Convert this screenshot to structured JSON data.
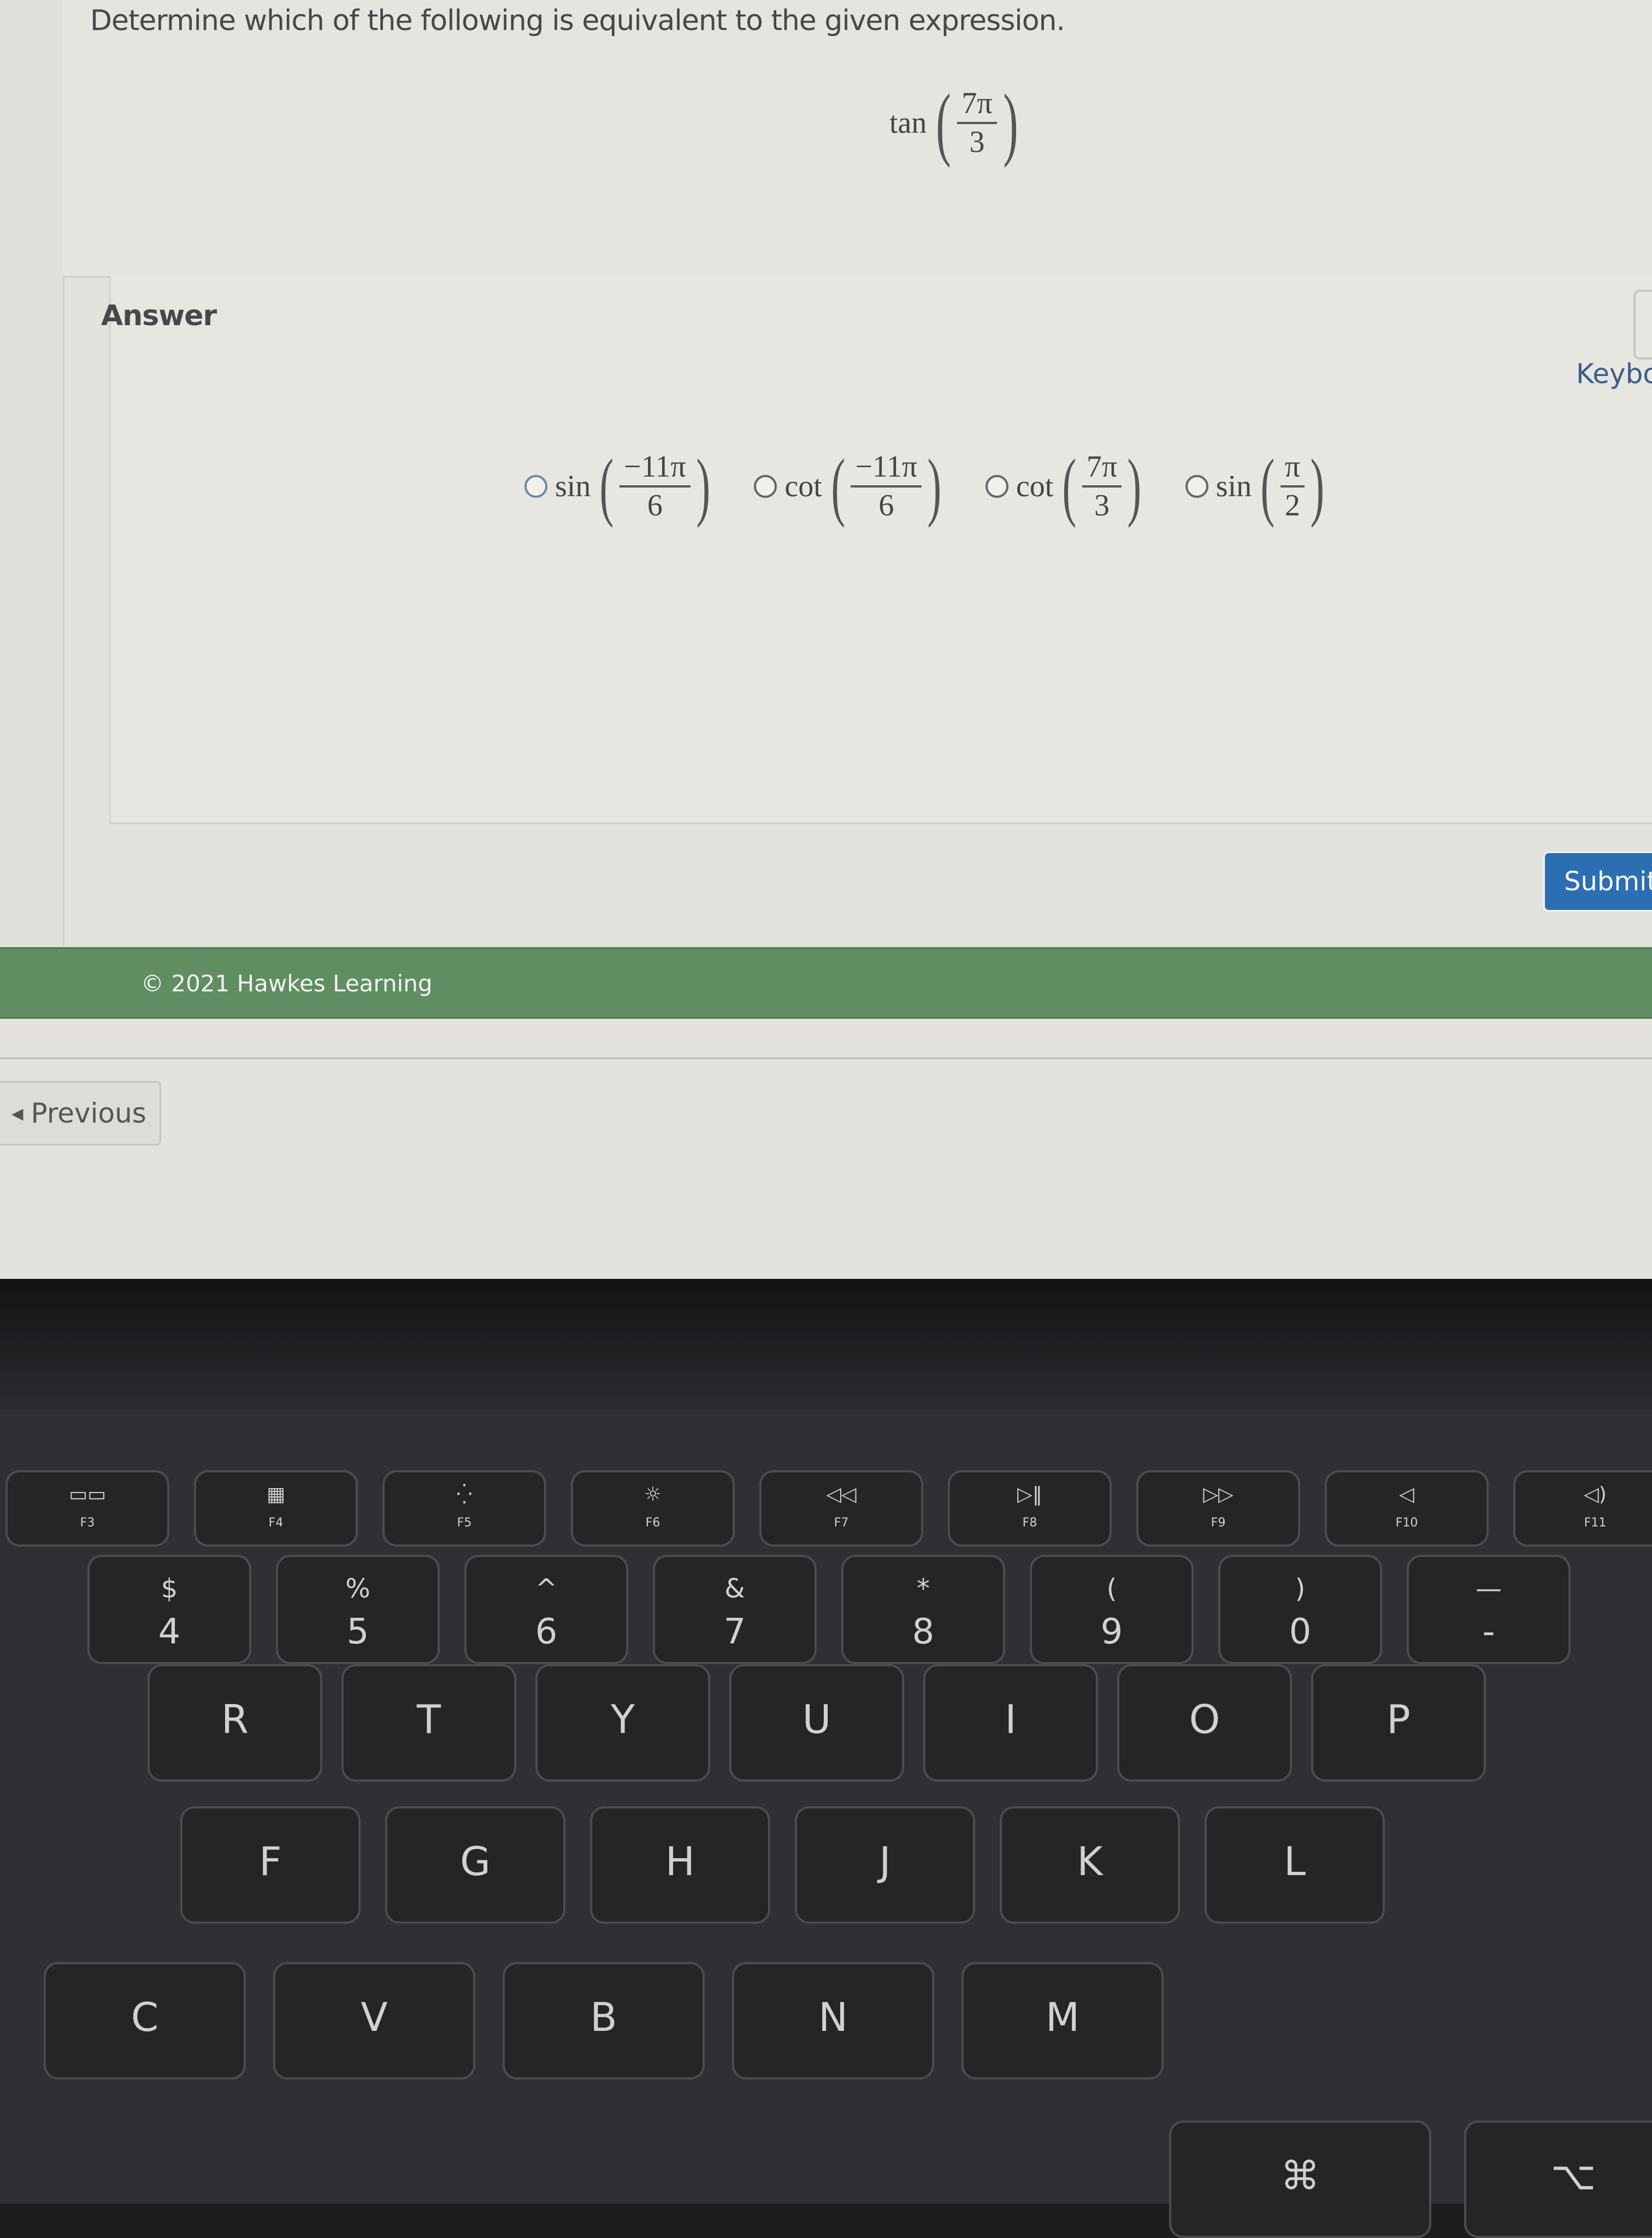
{
  "question": {
    "prompt": "Determine which of the following is equivalent to the given expression.",
    "expression": {
      "fn": "tan",
      "numerator": "7π",
      "denominator": "3"
    }
  },
  "answer": {
    "label": "Answer",
    "options": [
      {
        "fn": "sin",
        "numerator": "−11π",
        "denominator": "6",
        "selected": false
      },
      {
        "fn": "cot",
        "numerator": "−11π",
        "denominator": "6",
        "selected": false
      },
      {
        "fn": "cot",
        "numerator": "7π",
        "denominator": "3",
        "selected": false
      },
      {
        "fn": "sin",
        "numerator": "π",
        "denominator": "2",
        "selected": false
      }
    ],
    "keyboard_link": "Keybo",
    "submit_label": "Submit"
  },
  "footer": {
    "copyright": "© 2021 Hawkes Learning"
  },
  "nav": {
    "previous_label": "Previous",
    "previous_icon": "caret-left-icon"
  },
  "colors": {
    "footer_green": "#5f8e63",
    "submit_blue": "#2b6fb2",
    "link_blue": "#3a5d8a"
  },
  "keyboard": {
    "function_row": [
      {
        "sym": "▭▭",
        "label": "F3"
      },
      {
        "sym": "▦",
        "label": "F4"
      },
      {
        "sym": "⁛",
        "label": "F5"
      },
      {
        "sym": "☼",
        "label": "F6"
      },
      {
        "sym": "◁◁",
        "label": "F7"
      },
      {
        "sym": "▷‖",
        "label": "F8"
      },
      {
        "sym": "▷▷",
        "label": "F9"
      },
      {
        "sym": "◁",
        "label": "F10"
      },
      {
        "sym": "◁)",
        "label": "F11"
      }
    ],
    "number_row": [
      {
        "top": "$",
        "bot": "4"
      },
      {
        "top": "%",
        "bot": "5"
      },
      {
        "top": "^",
        "bot": "6"
      },
      {
        "top": "&",
        "bot": "7"
      },
      {
        "top": "*",
        "bot": "8"
      },
      {
        "top": "(",
        "bot": "9"
      },
      {
        "top": ")",
        "bot": "0"
      },
      {
        "top": "—",
        "bot": "-"
      }
    ],
    "top_row": [
      "R",
      "T",
      "Y",
      "U",
      "I",
      "O",
      "P"
    ],
    "home_row": [
      "F",
      "G",
      "H",
      "J",
      "K",
      "L"
    ],
    "bottom_row": [
      "C",
      "V",
      "B",
      "N",
      "M"
    ],
    "modifiers": {
      "command": "⌘",
      "option": "⌥"
    }
  }
}
